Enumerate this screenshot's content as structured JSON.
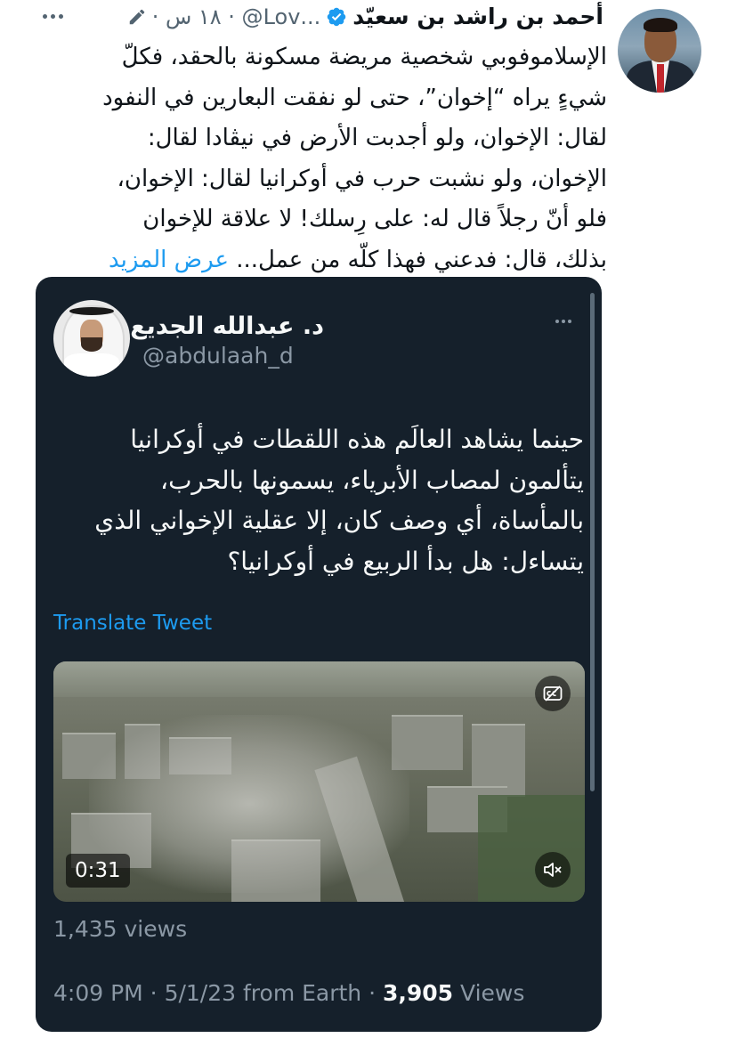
{
  "outer_tweet": {
    "display_name": "أحمد بن راشد بن سعيّد",
    "handle_time": "...Lov@ · ١٨ س ·",
    "text_lines": [
      "الإسلاموفوبي شخصية مريضة مسكونة بالحقد، فكلّ",
      "شيءٍ يراه “إخوان”، حتى لو نفقت البعارين في النفود",
      "لقال: الإخوان، ولو أجدبت الأرض في نيڤادا لقال:",
      "الإخوان، ولو نشبت حرب في أوكرانيا لقال: الإخوان،",
      "فلو أنّ رجلاً قال له: على رِسلك! لا علاقة للإخوان"
    ],
    "last_line_text": "بذلك، قال: فدعني فهذا كلّه من عمل...",
    "show_more": "عرض المزيد"
  },
  "quoted_tweet": {
    "display_name": "د. عبدالله الجديع",
    "handle": "@abdulaah_d",
    "text_lines": [
      "حينما يشاهد العالَم هذه اللقطات في أوكرانيا",
      "يتألمون لمصاب الأبرياء، يسمونها بالحرب،",
      "بالمأساة، أي وصف كان، إلا عقلية الإخواني الذي",
      "يتساءل: هل بدأ الربيع في أوكرانيا؟"
    ],
    "translate_label": "Translate Tweet",
    "video_duration": "0:31",
    "video_views": "1,435 views",
    "meta_prefix": "4:09 PM · 5/1/23 from Earth · ",
    "views_count": "3,905",
    "views_label": " Views"
  },
  "icons": {
    "verified": "verified-badge-icon",
    "edited": "edit-pencil-icon",
    "more": "more-dots-icon",
    "captions": "captions-off-icon",
    "mute": "volume-muted-icon"
  },
  "colors": {
    "accent": "#1d9bf0",
    "card_bg": "#15202b",
    "muted_text": "#536471",
    "dark_muted_text": "#8b98a5"
  }
}
